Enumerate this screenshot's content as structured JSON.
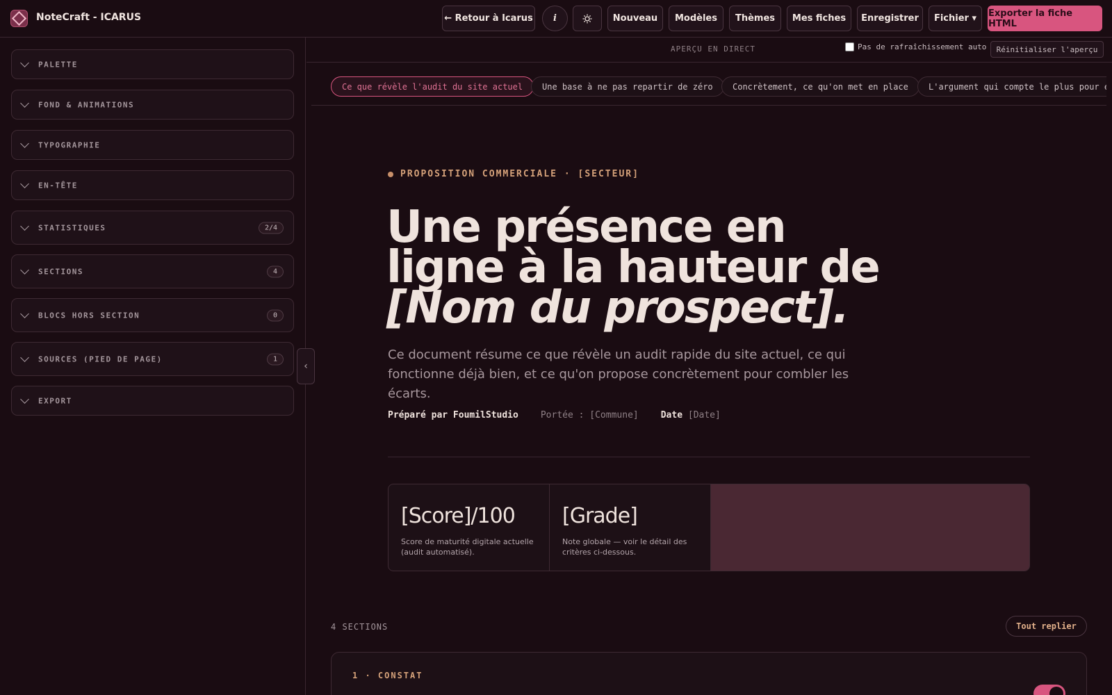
{
  "app": {
    "title": "NoteCraft - ICARUS"
  },
  "toolbar": {
    "back_label": "← Retour à Icarus",
    "info_icon": "info-icon",
    "theme_icon": "sun-icon",
    "new_label": "Nouveau",
    "templates_label": "Modèles",
    "themes_label": "Thèmes",
    "my_sheets_label": "Mes fiches",
    "save_label": "Enregistrer",
    "file_label": "Fichier ▾",
    "export_label": "Exporter la fiche HTML"
  },
  "sidebar": {
    "items": [
      {
        "label": "PALETTE",
        "badge": ""
      },
      {
        "label": "FOND & ANIMATIONS",
        "badge": ""
      },
      {
        "label": "TYPOGRAPHIE",
        "badge": ""
      },
      {
        "label": "EN-TÊTE",
        "badge": ""
      },
      {
        "label": "STATISTIQUES",
        "badge": "2/4"
      },
      {
        "label": "SECTIONS",
        "badge": "4"
      },
      {
        "label": "BLOCS HORS SECTION",
        "badge": "0"
      },
      {
        "label": "SOURCES (PIED DE PAGE)",
        "badge": "1"
      },
      {
        "label": "EXPORT",
        "badge": ""
      }
    ],
    "collapse_glyph": "‹"
  },
  "preview": {
    "label": "APERÇU EN DIRECT",
    "auto_refresh_label": "Pas de rafraîchissement auto",
    "auto_refresh_checked": false,
    "reset_label": "Réinitialiser l'aperçu",
    "tabs": [
      "Ce que révèle l'audit du site actuel",
      "Une base à ne pas repartir de zéro",
      "Concrètement, ce qu'on met en place",
      "L'argument qui compte le plus pour eu"
    ],
    "active_tab": 0
  },
  "document": {
    "eyebrow": "PROPOSITION COMMERCIALE · [SECTEUR]",
    "title_line1": "Une présence en",
    "title_line2": "ligne à la hauteur de",
    "title_line3": "[Nom du prospect].",
    "subtitle": "Ce document résume ce que révèle un audit rapide du site actuel, ce qui fonctionne déjà bien, et ce qu'on propose concrètement pour combler les écarts.",
    "meta": {
      "prepared_by": "Préparé par FoumilStudio",
      "scope": "Portée : [Commune]",
      "date_label": "Date",
      "date_value": "[Date]"
    },
    "stats": [
      {
        "value": "[Score]/100",
        "caption": "Score de maturité digitale actuelle (audit automatisé)."
      },
      {
        "value": "[Grade]",
        "caption": "Note globale — voir le détail des critères ci-dessous."
      }
    ],
    "sections_count": "4 SECTIONS",
    "fold_all_label": "Tout replier",
    "first_section_title": "1 · CONSTAT",
    "first_section_enabled": true
  },
  "colors": {
    "accent": "#d8557f",
    "eyebrow": "#d6a27a",
    "background": "#1a0c12"
  }
}
